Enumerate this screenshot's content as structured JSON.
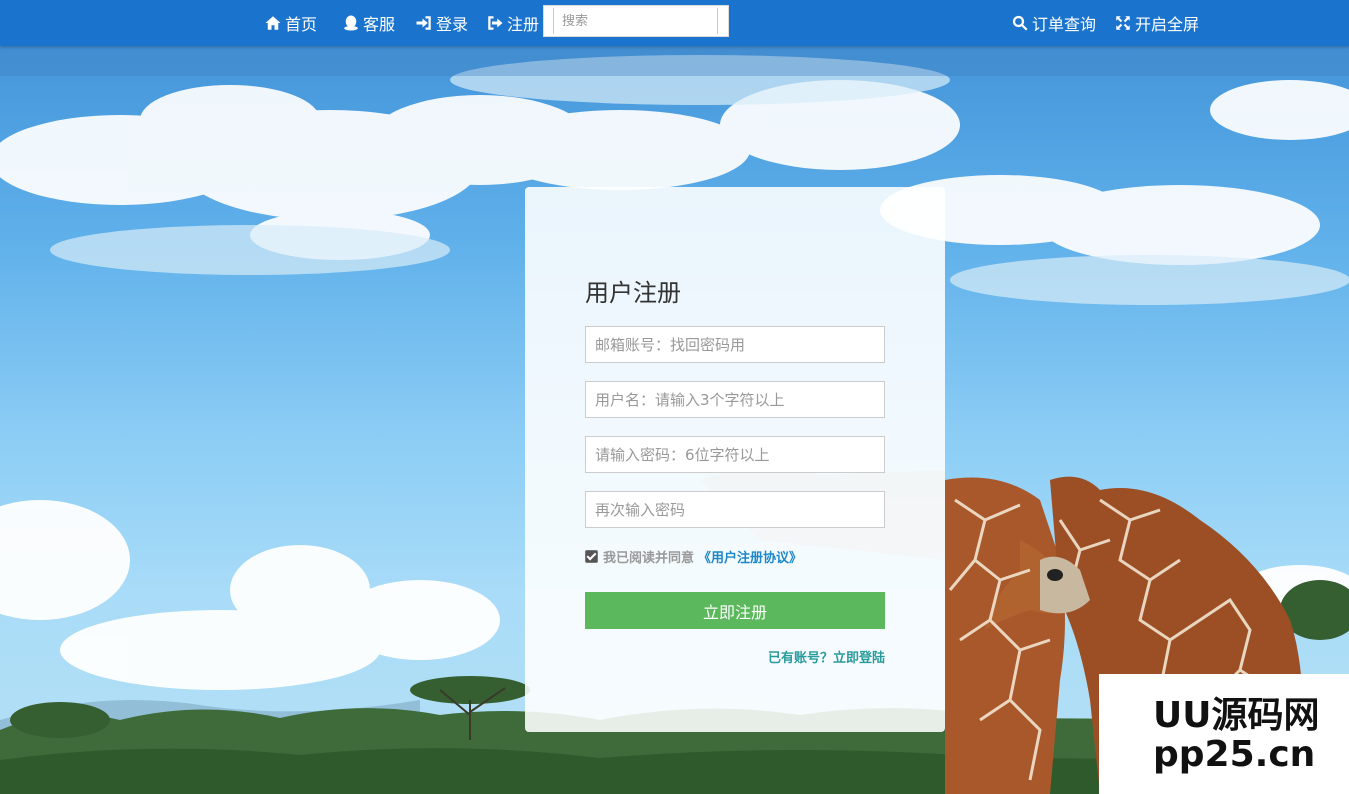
{
  "nav": {
    "home": "首页",
    "service": "客服",
    "login": "登录",
    "register": "注册",
    "search_placeholder": "搜索",
    "order_query": "订单查询",
    "fullscreen": "开启全屏"
  },
  "form": {
    "title": "用户注册",
    "email_placeholder": "邮箱账号：找回密码用",
    "username_placeholder": "用户名：请输入3个字符以上",
    "password_placeholder": "请输入密码：6位字符以上",
    "confirm_placeholder": "再次输入密码",
    "agree_text": "我已阅读并同意",
    "agreement_link": "《用户注册协议》",
    "submit_label": "立即注册",
    "login_link": "已有账号？立即登陆"
  },
  "watermark": {
    "line1": "UU源码网",
    "line2": "pp25.cn"
  },
  "colors": {
    "navbar": "#1a73cc",
    "submit": "#5cb85c",
    "link": "#1e88c7",
    "login_link": "#2a9b9b"
  }
}
